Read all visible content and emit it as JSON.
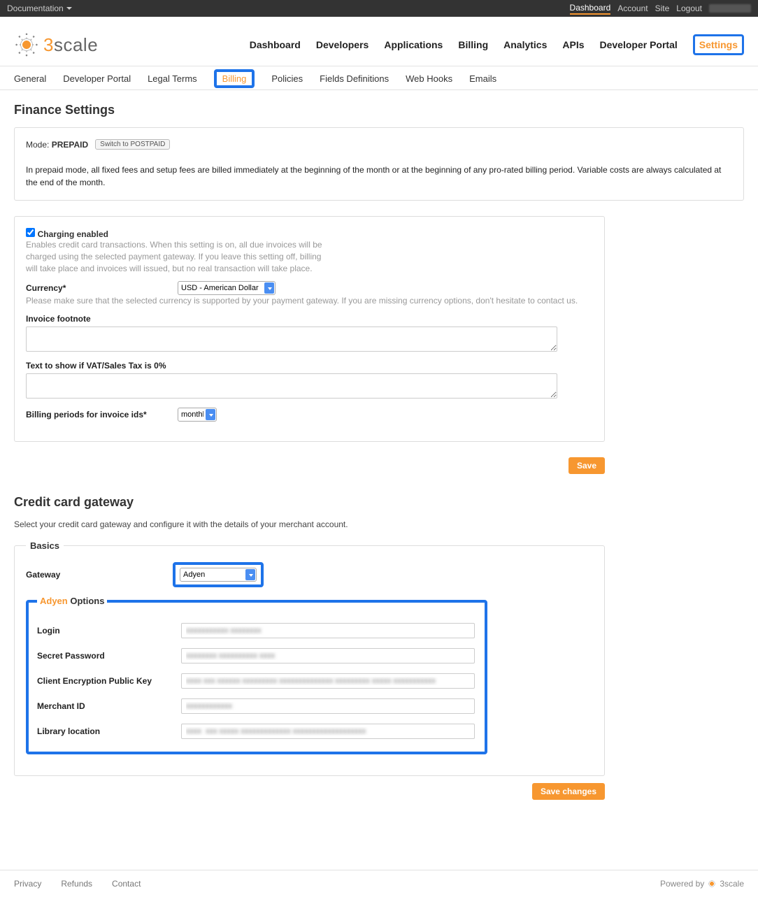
{
  "topbar": {
    "left": "Documentation",
    "items": [
      "Dashboard",
      "Account",
      "Site",
      "Logout"
    ],
    "active": "Dashboard"
  },
  "brand": {
    "name_prefix": "3",
    "name_rest": "scale"
  },
  "mainnav": {
    "items": [
      "Dashboard",
      "Developers",
      "Applications",
      "Billing",
      "Analytics",
      "APIs",
      "Developer Portal",
      "Settings"
    ],
    "highlight": "Settings"
  },
  "subnav": {
    "items": [
      "General",
      "Developer Portal",
      "Legal Terms",
      "Billing",
      "Policies",
      "Fields Definitions",
      "Web Hooks",
      "Emails"
    ],
    "active": "Billing"
  },
  "finance": {
    "heading": "Finance Settings",
    "mode_label": "Mode:",
    "mode_value": "PREPAID",
    "switch_button": "Switch to POSTPAID",
    "mode_desc": "In prepaid mode, all fixed fees and setup fees are billed immediately at the beginning of the month or at the beginning of any pro-rated billing period. Variable costs are always calculated at the end of the month.",
    "charging_label": "Charging enabled",
    "charging_checked": true,
    "charging_help": "Enables credit card transactions. When this setting is on, all due invoices will be charged using the selected payment gateway. If you leave this setting off, billing will take place and invoices will issued, but no real transaction will take place.",
    "currency_label": "Currency*",
    "currency_value": "USD - American Dollar",
    "currency_help": "Please make sure that the selected currency is supported by your payment gateway. If you are missing currency options, don't hesitate to contact us.",
    "invoice_footnote_label": "Invoice footnote",
    "invoice_footnote_value": "",
    "vat_label": "Text to show if VAT/Sales Tax is 0%",
    "vat_value": "",
    "billing_periods_label": "Billing periods for invoice ids*",
    "billing_periods_value": "monthly",
    "save_button": "Save"
  },
  "gateway": {
    "heading": "Credit card gateway",
    "sub": "Select your credit card gateway and configure it with the details of your merchant account.",
    "basics_legend": "Basics",
    "gateway_label": "Gateway",
    "gateway_value": "Adyen",
    "options_legend_name": "Adyen",
    "options_legend_rest": " Options",
    "fields": {
      "login_label": "Login",
      "secret_label": "Secret Password",
      "pubkey_label": "Client Encryption Public Key",
      "merchant_label": "Merchant ID",
      "library_label": "Library location"
    },
    "save_button": "Save changes"
  },
  "footer": {
    "links": [
      "Privacy",
      "Refunds",
      "Contact"
    ],
    "powered": "Powered by",
    "powered_name": "3scale"
  }
}
